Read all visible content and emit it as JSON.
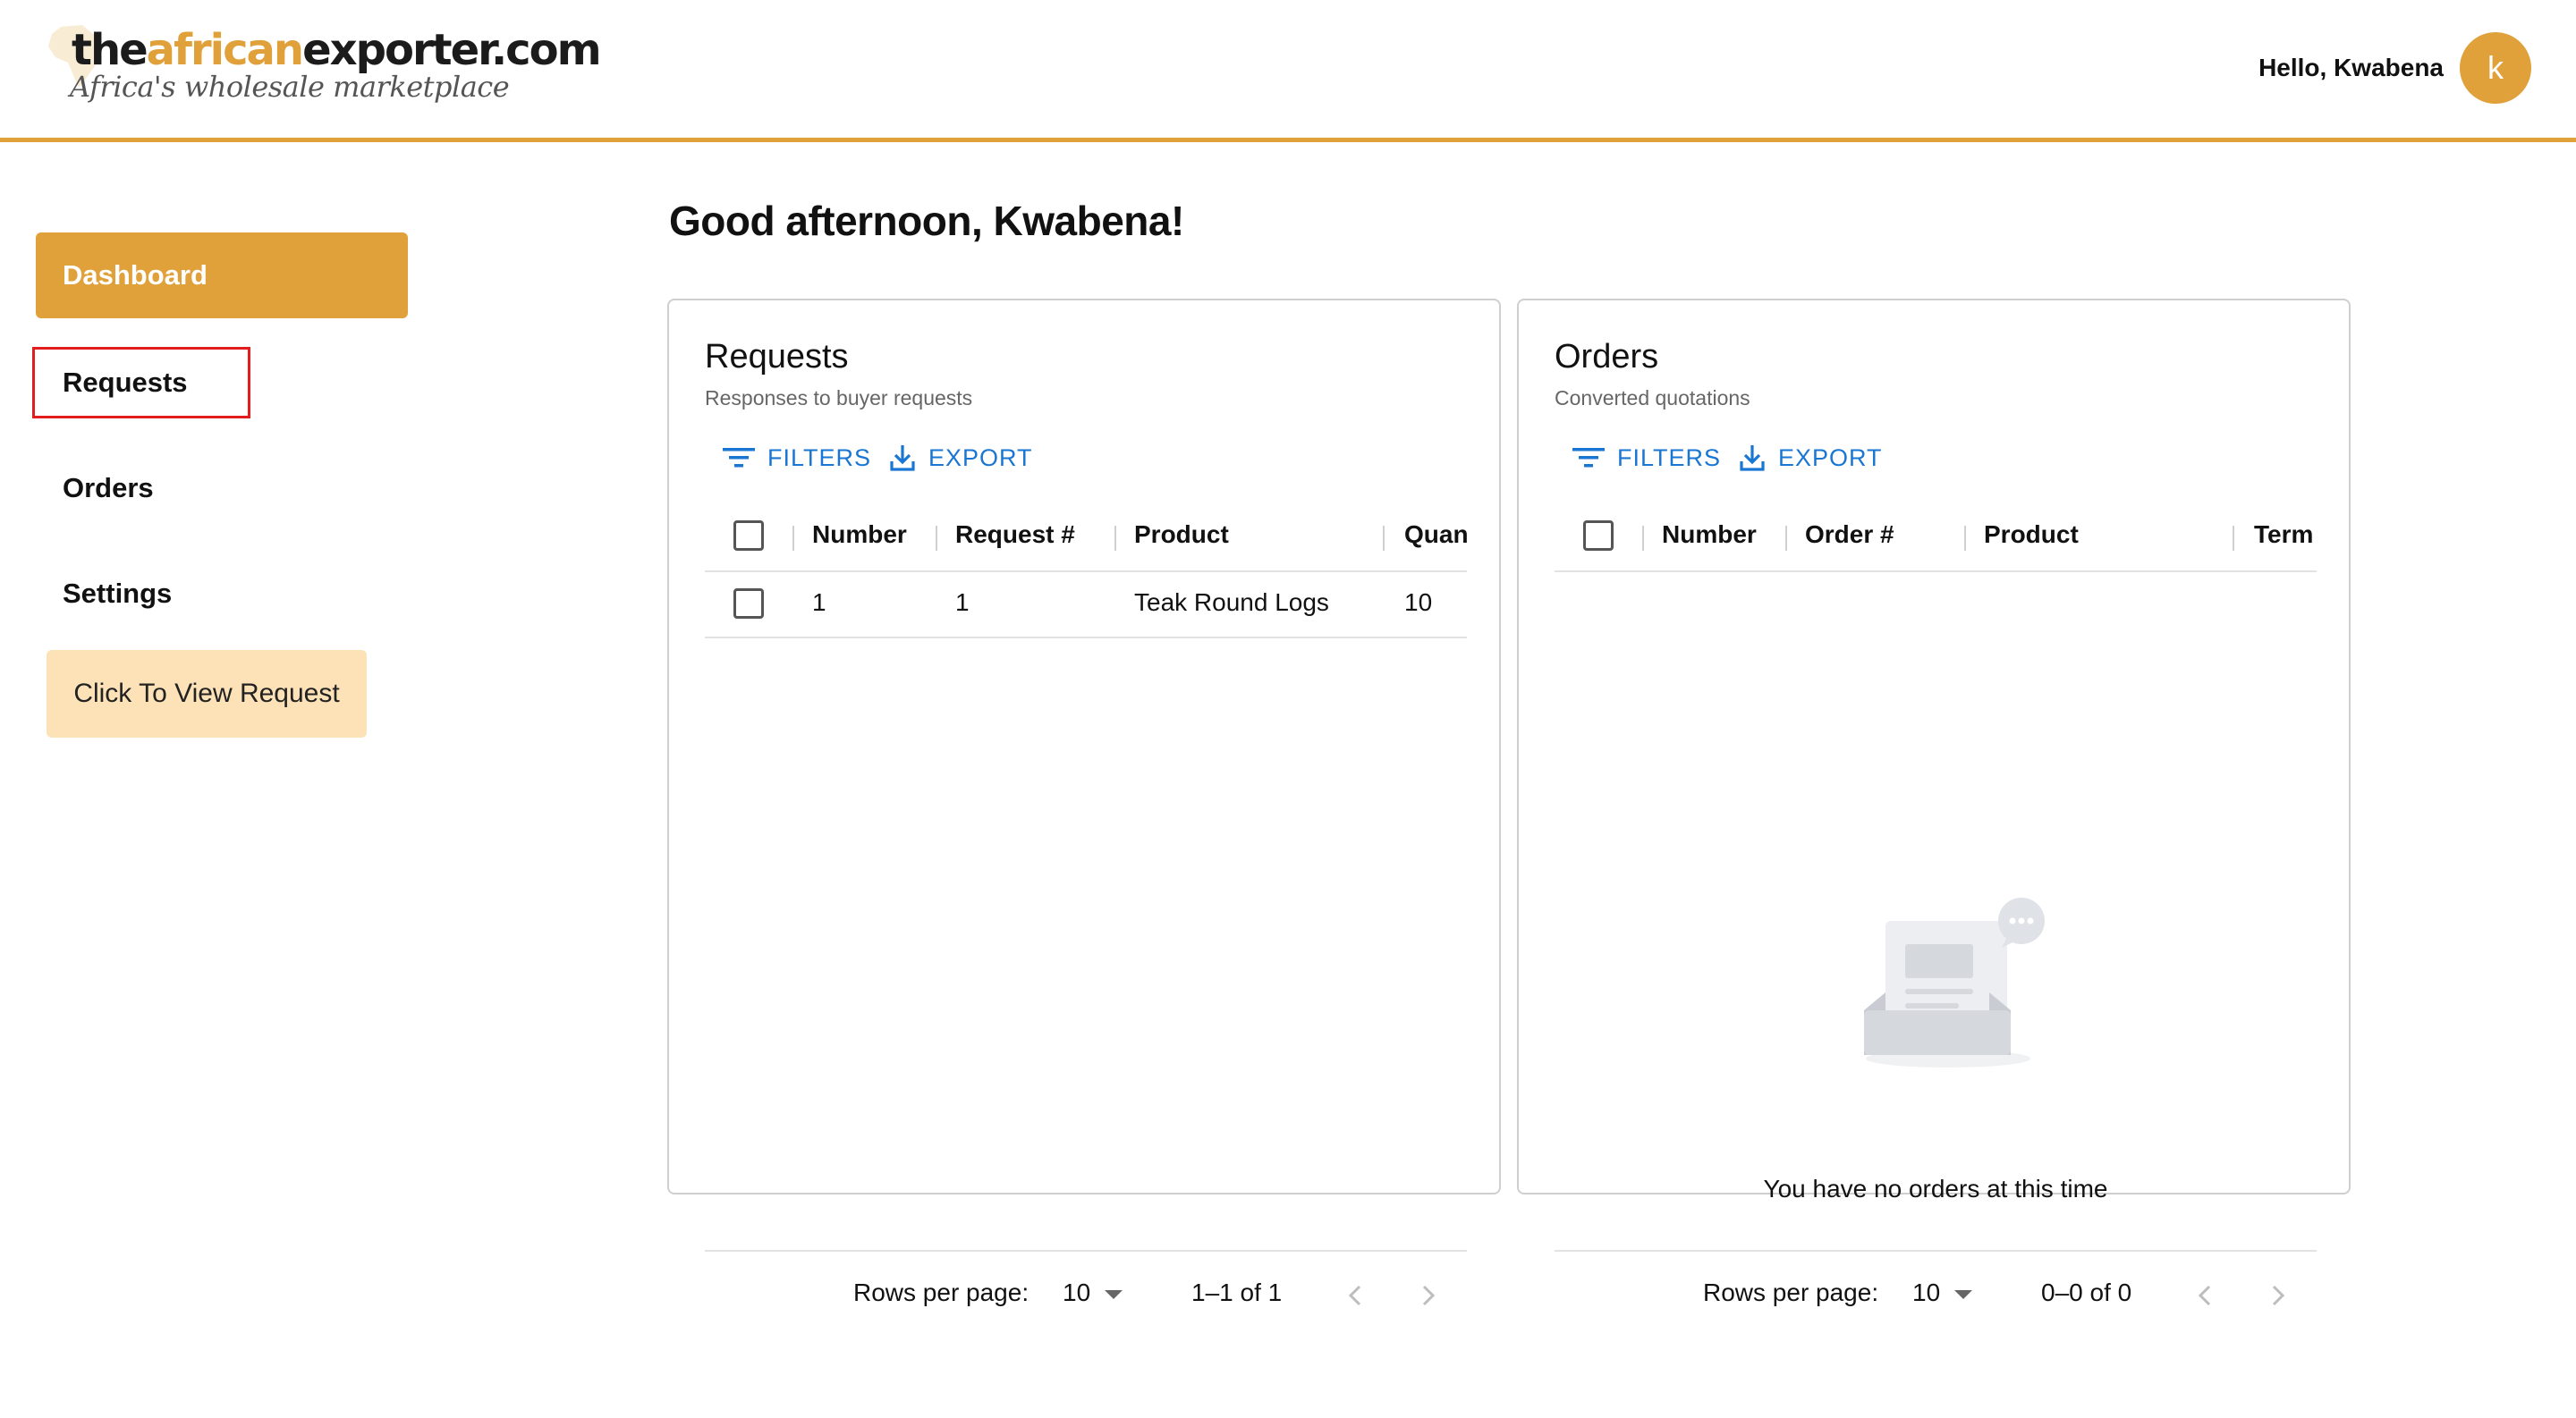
{
  "brand": {
    "logo_part1": "the",
    "logo_part2": "african",
    "logo_part3": "exporter.com",
    "tagline": "Africa's wholesale marketplace",
    "accent_color": "#e0a03a"
  },
  "header": {
    "greeting": "Hello, Kwabena",
    "avatar_letter": "k"
  },
  "sidebar": {
    "items": [
      {
        "label": "Dashboard",
        "active": true
      },
      {
        "label": "Requests",
        "active": false
      },
      {
        "label": "Orders",
        "active": false
      },
      {
        "label": "Settings",
        "active": false
      }
    ],
    "view_request_button": "Click To View Request"
  },
  "main": {
    "welcome": "Good afternoon, Kwabena!",
    "requests_card": {
      "title": "Requests",
      "subtitle": "Responses to buyer requests",
      "filters_label": "FILTERS",
      "export_label": "EXPORT",
      "columns": [
        "Number",
        "Request #",
        "Product",
        "Quan"
      ],
      "rows": [
        {
          "number": "1",
          "request_no": "1",
          "product": "Teak Round Logs",
          "quantity": "10"
        }
      ],
      "rows_per_page_label": "Rows per page:",
      "rows_per_page_value": "10",
      "range": "1–1 of 1"
    },
    "orders_card": {
      "title": "Orders",
      "subtitle": "Converted quotations",
      "filters_label": "FILTERS",
      "export_label": "EXPORT",
      "columns": [
        "Number",
        "Order #",
        "Product",
        "Term"
      ],
      "empty_message": "You have no orders at this time",
      "rows_per_page_label": "Rows per page:",
      "rows_per_page_value": "10",
      "range": "0–0 of 0"
    }
  }
}
